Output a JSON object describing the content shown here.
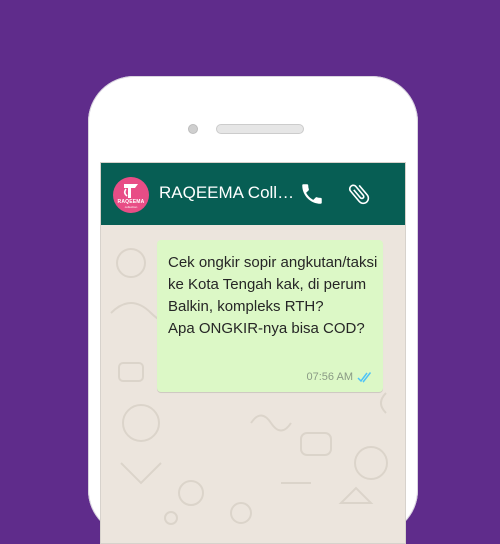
{
  "chat": {
    "contact_name": "RAQEEMA Colle...",
    "avatar": {
      "brand": "RAQEEMA",
      "tagline": "collection",
      "color": "#e84d86"
    },
    "header_color": "#075e54",
    "icons": {
      "call": "phone-icon",
      "attach": "paperclip-icon",
      "read_receipt": "double-check-icon"
    }
  },
  "message": {
    "text": "Cek ongkir sopir angkutan/taksi ke Kota Tengah kak, di perum Balkin, kompleks RTH?\nApa ONGKIR-nya bisa COD?",
    "time": "07:56 AM",
    "bubble_color": "#dcf8c6",
    "tick_color": "#4fc3f7"
  }
}
